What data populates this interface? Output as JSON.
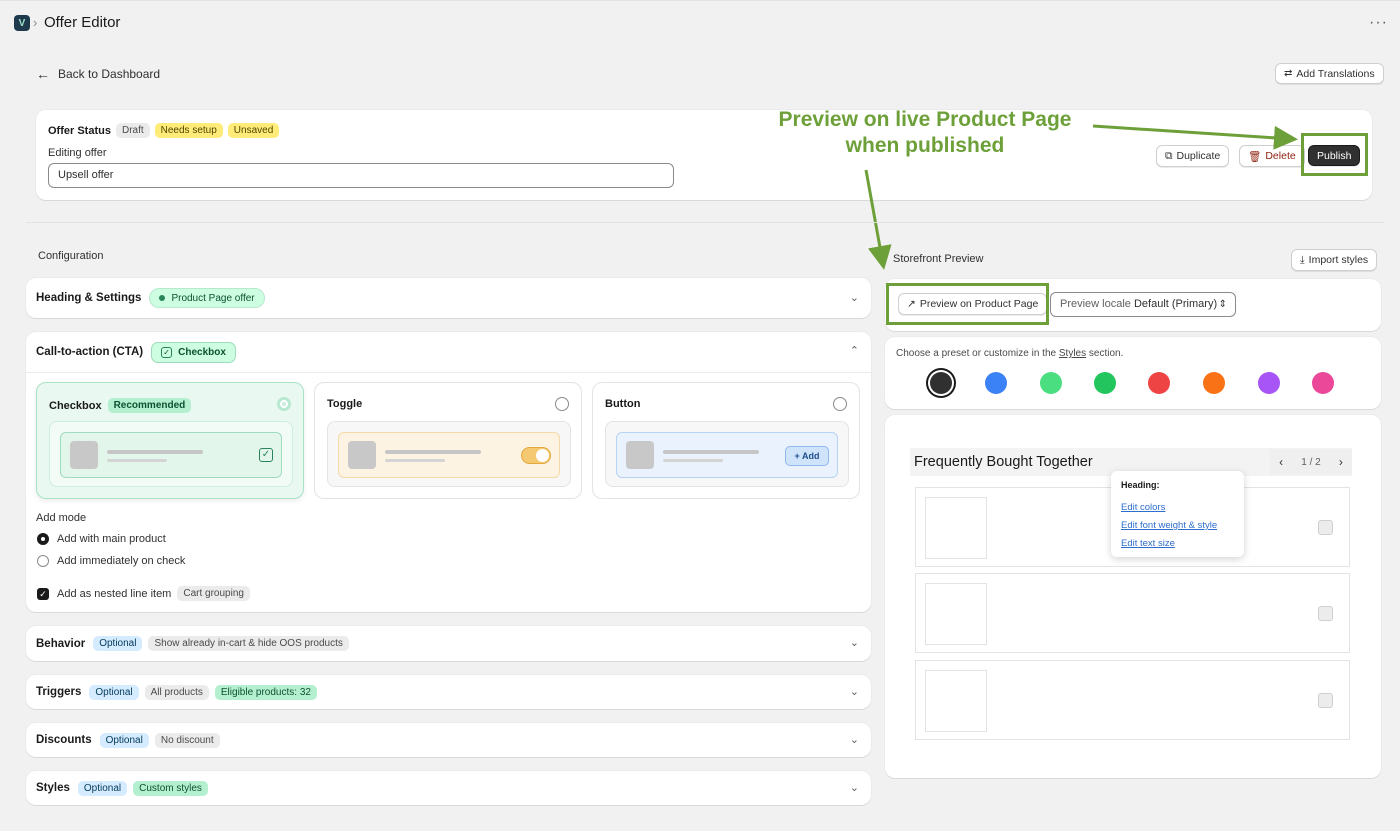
{
  "topbar": {
    "title": "Offer Editor",
    "separator": "›",
    "more": "···"
  },
  "header": {
    "back_label": "Back to Dashboard",
    "add_translations_label": "Add Translations"
  },
  "status_card": {
    "offer_status_label": "Offer Status",
    "badges": {
      "draft": "Draft",
      "needs_setup": "Needs setup",
      "unsaved": "Unsaved"
    },
    "editing_label": "Editing offer",
    "offer_name_value": "Upsell offer",
    "duplicate_label": "Duplicate",
    "delete_label": "Delete",
    "publish_label": "Publish"
  },
  "annotation": {
    "line1": "Preview on live Product Page",
    "line2": "when published",
    "color": "#6ea03a"
  },
  "configuration": {
    "label": "Configuration",
    "heading_settings": {
      "title": "Heading & Settings",
      "badge": "Product Page offer"
    },
    "cta": {
      "title": "Call-to-action (CTA)",
      "badge": "Checkbox",
      "options": {
        "checkbox": {
          "title": "Checkbox",
          "badge": "Recommended"
        },
        "toggle": {
          "title": "Toggle"
        },
        "button": {
          "title": "Button",
          "add_label": "+ Add"
        }
      },
      "add_mode_label": "Add mode",
      "add_with_main": "Add with main product",
      "add_immediately": "Add immediately on check",
      "nested_label": "Add as nested line item",
      "nested_badge": "Cart grouping"
    },
    "behavior": {
      "title": "Behavior",
      "optional": "Optional",
      "badge": "Show already in-cart & hide OOS products"
    },
    "triggers": {
      "title": "Triggers",
      "optional": "Optional",
      "badge1": "All products",
      "badge2": "Eligible products: 32"
    },
    "discounts": {
      "title": "Discounts",
      "optional": "Optional",
      "badge": "No discount"
    },
    "styles": {
      "title": "Styles",
      "optional": "Optional",
      "badge": "Custom styles"
    }
  },
  "preview": {
    "label": "Storefront Preview",
    "import_styles_label": "Import styles",
    "preview_product_label": "Preview on Product Page",
    "locale_prefix": "Preview locale",
    "locale_value": "Default (Primary)",
    "preset_text_before": "Choose a preset or customize in the",
    "preset_link": "Styles",
    "preset_text_after": "section.",
    "swatches": [
      "#303030",
      "#3b82f6",
      "#4ade80",
      "#22c55e",
      "#ef4444",
      "#f97316",
      "#a855f7",
      "#ec4899"
    ],
    "widget_title": "Frequently Bought Together",
    "pager": "1 / 2",
    "popover": {
      "title": "Heading:",
      "edit_colors": "Edit colors",
      "edit_font": "Edit font weight & style",
      "edit_size": "Edit text size"
    }
  }
}
